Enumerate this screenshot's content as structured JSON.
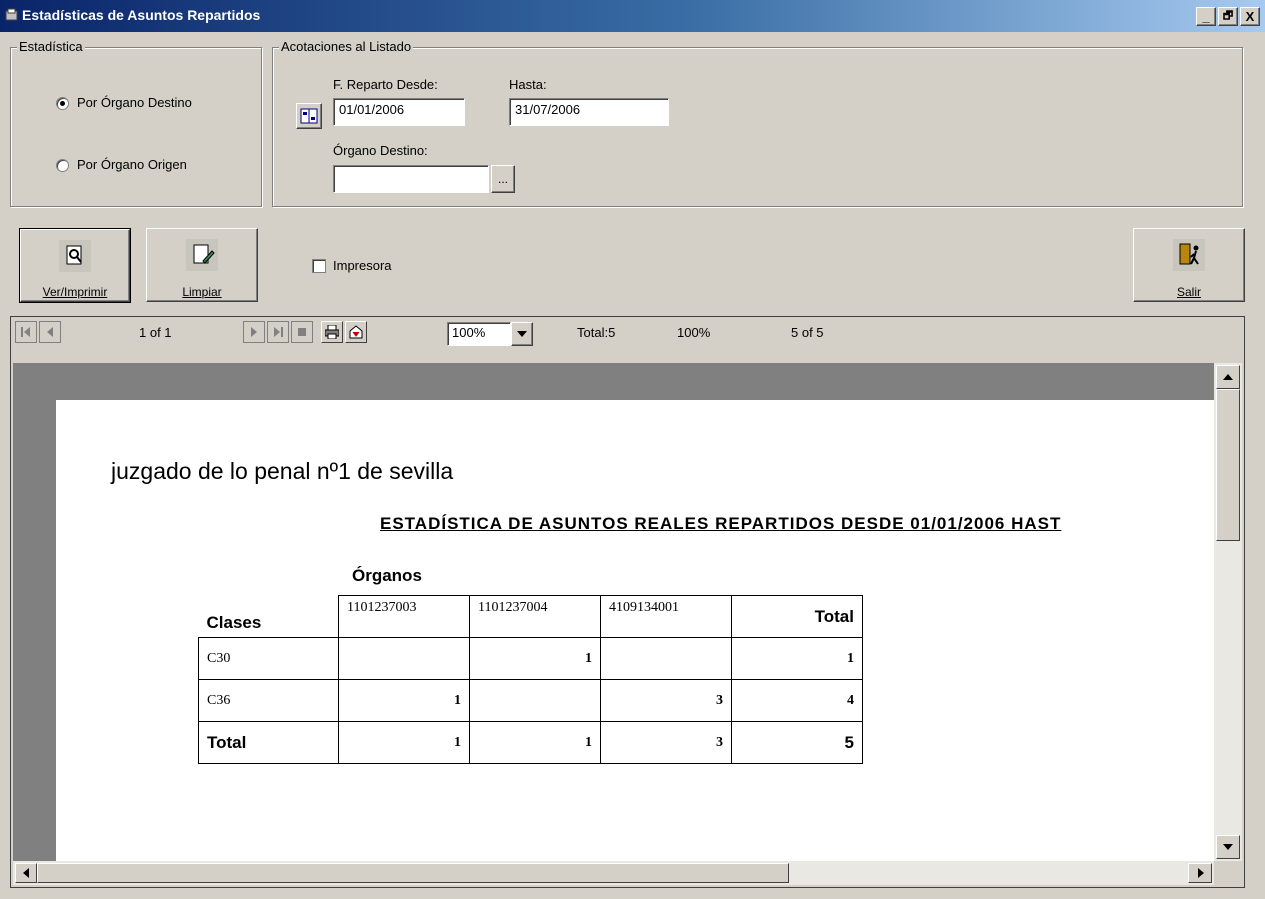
{
  "window": {
    "title": "Estadísticas de Asuntos Repartidos",
    "controls": [
      "_",
      "🗗",
      "X"
    ]
  },
  "estadistica": {
    "legend": "Estadística",
    "options": [
      {
        "label": "Por  Órgano Destino",
        "selected": true
      },
      {
        "label": "Por  Órgano Origen",
        "selected": false
      }
    ]
  },
  "acotaciones": {
    "legend": "Acotaciones al Listado",
    "desde_label": "F. Reparto Desde:",
    "desde_value": "01/01/2006",
    "hasta_label": "Hasta:",
    "hasta_value": "31/07/2006",
    "organo_label": "Órgano Destino:",
    "organo_value": "",
    "browse_label": "..."
  },
  "actions": {
    "ver_label": "Ver/Imprimir",
    "limpiar_label": "Limpiar",
    "impresora_label": "Impresora",
    "impresora_checked": false,
    "salir_label": "Salir"
  },
  "viewer_toolbar": {
    "page": "1 of 1",
    "zoom": "100%",
    "total": "Total:5",
    "percent": "100%",
    "records": "5 of 5"
  },
  "report": {
    "heading": "juzgado de lo penal nº1 de sevilla",
    "subtitle": "ESTADÍSTICA DE ASUNTOS REALES REPARTIDOS DESDE 01/01/2006 HAST",
    "organos_label": "Órganos",
    "clases_label": "Clases",
    "columns": [
      "1101237003",
      "1101237004",
      "4109134001",
      "Total"
    ],
    "rows": [
      {
        "label": "C30",
        "values": [
          "",
          "1",
          "",
          "1"
        ]
      },
      {
        "label": "C36",
        "values": [
          "1",
          "",
          "3",
          "4"
        ]
      },
      {
        "label": "Total",
        "values": [
          "1",
          "1",
          "3",
          "5"
        ]
      }
    ]
  }
}
